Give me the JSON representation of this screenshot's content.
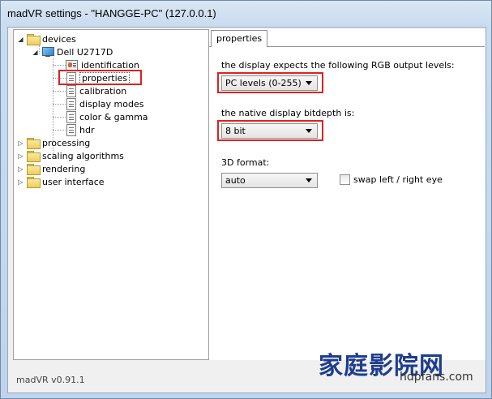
{
  "window": {
    "title": "madVR settings - \"HANGGE-PC\" (127.0.0.1)"
  },
  "tree": {
    "items": [
      {
        "label": "devices"
      },
      {
        "label": "Dell U2717D"
      },
      {
        "label": "identification"
      },
      {
        "label": "properties"
      },
      {
        "label": "calibration"
      },
      {
        "label": "display modes"
      },
      {
        "label": "color & gamma"
      },
      {
        "label": "hdr"
      },
      {
        "label": "processing"
      },
      {
        "label": "scaling algorithms"
      },
      {
        "label": "rendering"
      },
      {
        "label": "user interface"
      }
    ]
  },
  "tab": {
    "label": "properties"
  },
  "form": {
    "rgb_label": "the display expects the following RGB output levels:",
    "rgb_value": "PC levels (0-255)",
    "bitdepth_label": "the native display bitdepth is:",
    "bitdepth_value": "8 bit",
    "format3d_label": "3D format:",
    "format3d_value": "auto",
    "swap_label": "swap left / right eye"
  },
  "status": {
    "version": "madVR v0.91.1"
  },
  "watermark": {
    "cn": "家庭影院网",
    "site": "hdpfans.com"
  },
  "colors": {
    "highlight_box": "#e02020",
    "watermark": "#1f3d8f"
  }
}
